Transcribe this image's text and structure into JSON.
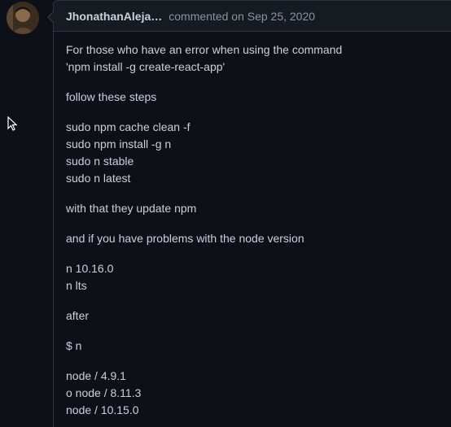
{
  "comment": {
    "author": "JhonathanAleja…",
    "action": "commented on Sep 25, 2020",
    "paragraphs": [
      {
        "lines": [
          "For those who have an error when using the command",
          "'npm install -g create-react-app'"
        ]
      },
      {
        "lines": [
          "follow these steps"
        ]
      },
      {
        "lines": [
          "sudo npm cache clean -f",
          "sudo npm install -g n",
          "sudo n stable",
          "sudo n latest"
        ]
      },
      {
        "lines": [
          "with that they update npm"
        ]
      },
      {
        "lines": [
          "and if you have problems with the node version"
        ]
      },
      {
        "lines": [
          "n 10.16.0",
          "n lts"
        ]
      },
      {
        "lines": [
          "after"
        ]
      },
      {
        "lines": [
          "$ n"
        ]
      },
      {
        "lines": [
          "node / 4.9.1",
          "o node / 8.11.3",
          "node / 10.15.0"
        ]
      }
    ]
  },
  "icons": {
    "avatar": "user-avatar",
    "cursor": "mouse-pointer-icon"
  },
  "colors": {
    "background": "#0d1117",
    "header_background": "#161b22",
    "border": "#30363d",
    "text": "#c9d1d9",
    "muted": "#8b949e"
  }
}
